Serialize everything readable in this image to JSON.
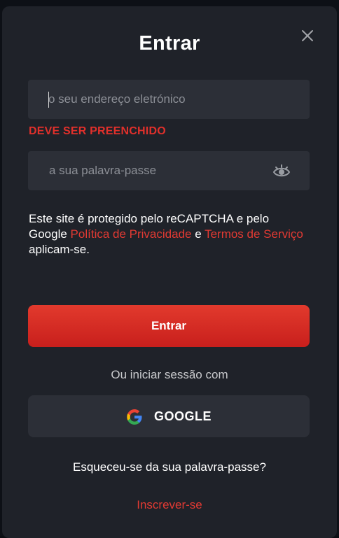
{
  "modal": {
    "title": "Entrar",
    "close_icon": "close-icon"
  },
  "email": {
    "placeholder": "o seu endereço eletrónico",
    "value": "",
    "error": "DEVE SER PREENCHIDO"
  },
  "password": {
    "placeholder": "a sua palavra-passe",
    "value": "",
    "toggle_icon": "eye-icon"
  },
  "recaptcha": {
    "text_before": "Este site é protegido pelo reCAPTCHA e pelo Google ",
    "privacy_link": "Política de Privacidade",
    "connector": " e ",
    "terms_link": "Termos de Serviço",
    "text_after": " aplicam-se."
  },
  "submit": {
    "label": "Entrar"
  },
  "alt_login": {
    "label": "Ou iniciar sessão com",
    "google_label": "GOOGLE",
    "google_icon": "google-icon"
  },
  "forgot_password": "Esqueceu-se da sua palavra-passe?",
  "register": "Inscrever-se",
  "colors": {
    "accent": "#e0302b",
    "panel": "#1f2229",
    "field": "#2c2f37"
  }
}
